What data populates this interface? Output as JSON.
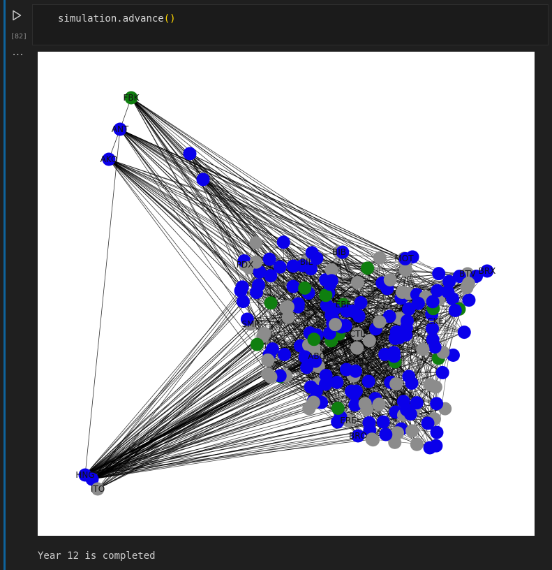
{
  "cell": {
    "execution_count": "[82]",
    "code": {
      "object": "simulation",
      "dot": ".",
      "method": "advance",
      "parens": "()"
    },
    "output_menu_glyph": "···",
    "stdout": "Year 12 is completed"
  },
  "graph": {
    "node_colors": {
      "blue": "#0a00ea",
      "gray": "#8c8c8c",
      "green": "#0f7f0f"
    },
    "edge_color": "#000000",
    "labels": [
      "FBK",
      "ANT",
      "AKO",
      "MOT",
      "BTV",
      "PDX",
      "BIL",
      "EBF",
      "BIB",
      "HNG",
      "ITO",
      "BRX",
      "BRO",
      "ERE",
      "ABO",
      "CTL",
      "BPQ",
      "SMP",
      "CKE"
    ]
  }
}
